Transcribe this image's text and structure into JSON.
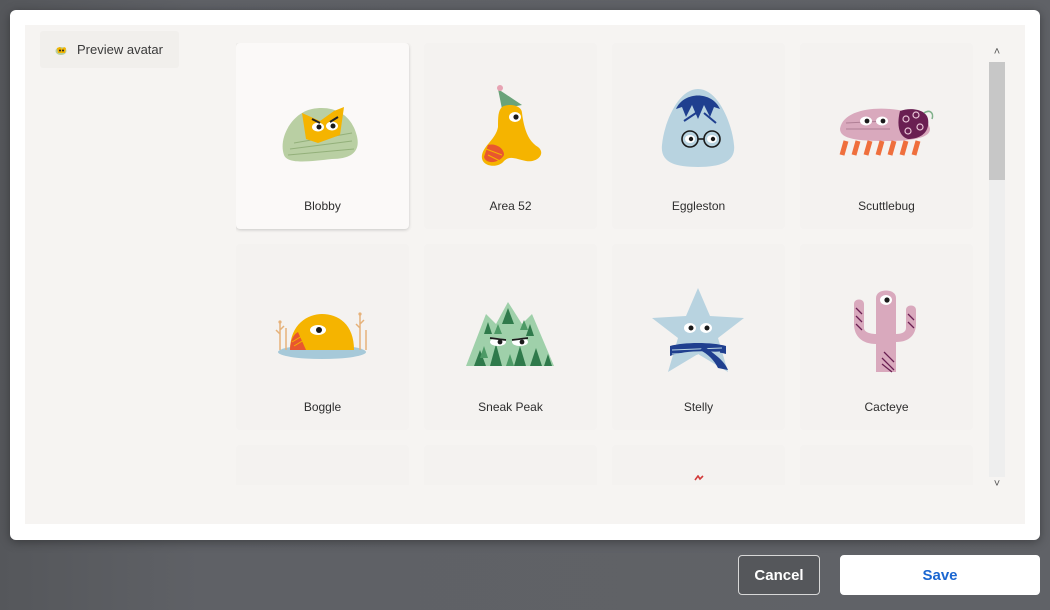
{
  "preview": {
    "label": "Preview avatar"
  },
  "avatars": [
    {
      "name": "Blobby",
      "selected": true
    },
    {
      "name": "Area 52"
    },
    {
      "name": "Eggleston"
    },
    {
      "name": "Scuttlebug"
    },
    {
      "name": "Boggle"
    },
    {
      "name": "Sneak Peak"
    },
    {
      "name": "Stelly"
    },
    {
      "name": "Cacteye"
    }
  ],
  "buttons": {
    "cancel": "Cancel",
    "save": "Save"
  },
  "colors": {
    "save_text": "#1a66d1",
    "backdrop": "#5f6166"
  }
}
